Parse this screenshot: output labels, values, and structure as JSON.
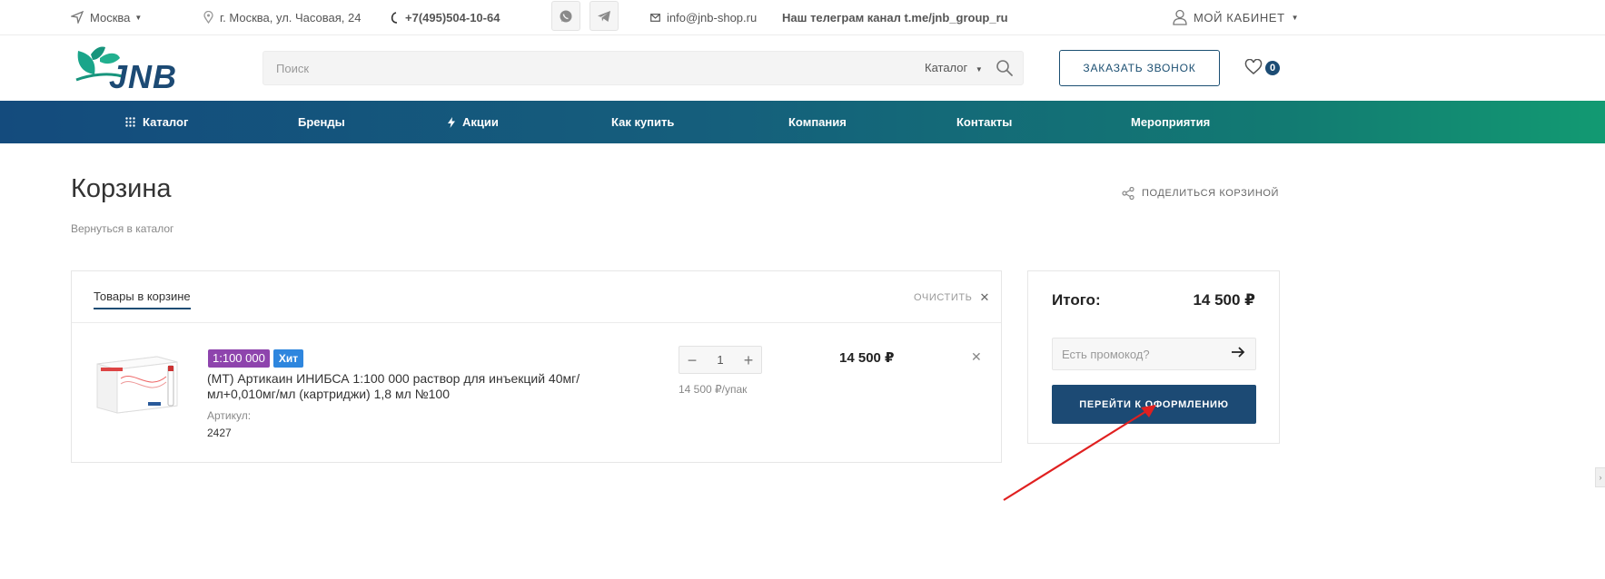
{
  "topbar": {
    "city": "Москва",
    "address": "г. Москва, ул. Часовая, 24",
    "phone": "+7(495)504-10-64",
    "email": "info@jnb-shop.ru",
    "telegram_text": "Наш телеграм канал t.me/jnb_group_ru",
    "cabinet": "МОЙ КАБИНЕТ"
  },
  "header": {
    "logo_text": "JNB",
    "search_placeholder": "Поиск",
    "search_category": "Каталог",
    "call_button": "ЗАКАЗАТЬ ЗВОНОК",
    "favorites_count": "0"
  },
  "nav": {
    "items": [
      "Каталог",
      "Бренды",
      "Акции",
      "Как купить",
      "Компания",
      "Контакты",
      "Мероприятия"
    ]
  },
  "page": {
    "title": "Корзина",
    "back_link": "Вернуться в каталог",
    "share": "ПОДЕЛИТЬСЯ КОРЗИНОЙ"
  },
  "cart": {
    "tab": "Товары в корзине",
    "clear": "ОЧИСТИТЬ",
    "item": {
      "badge1": "1:100 000",
      "badge2": "Хит",
      "name": "(МТ) Артикаин ИНИБСА 1:100 000 раствор для инъекций 40мг/мл+0,010мг/мл (картриджи) 1,8 мл №100",
      "article_label": "Артикул:",
      "article": "2427",
      "quantity": "1",
      "unit_price": "14 500 ₽/упак",
      "price": "14 500 ₽"
    }
  },
  "summary": {
    "total_label": "Итого:",
    "total_value": "14 500 ₽",
    "promo_placeholder": "Есть промокод?",
    "checkout": "ПЕРЕЙТИ К ОФОРМЛЕНИЮ"
  },
  "colors": {
    "brand_dark": "#1c4a74",
    "brand_green": "#129a72",
    "badge_purple": "#8e44ad",
    "badge_blue": "#2e86de",
    "annotation_red": "#e02020"
  }
}
